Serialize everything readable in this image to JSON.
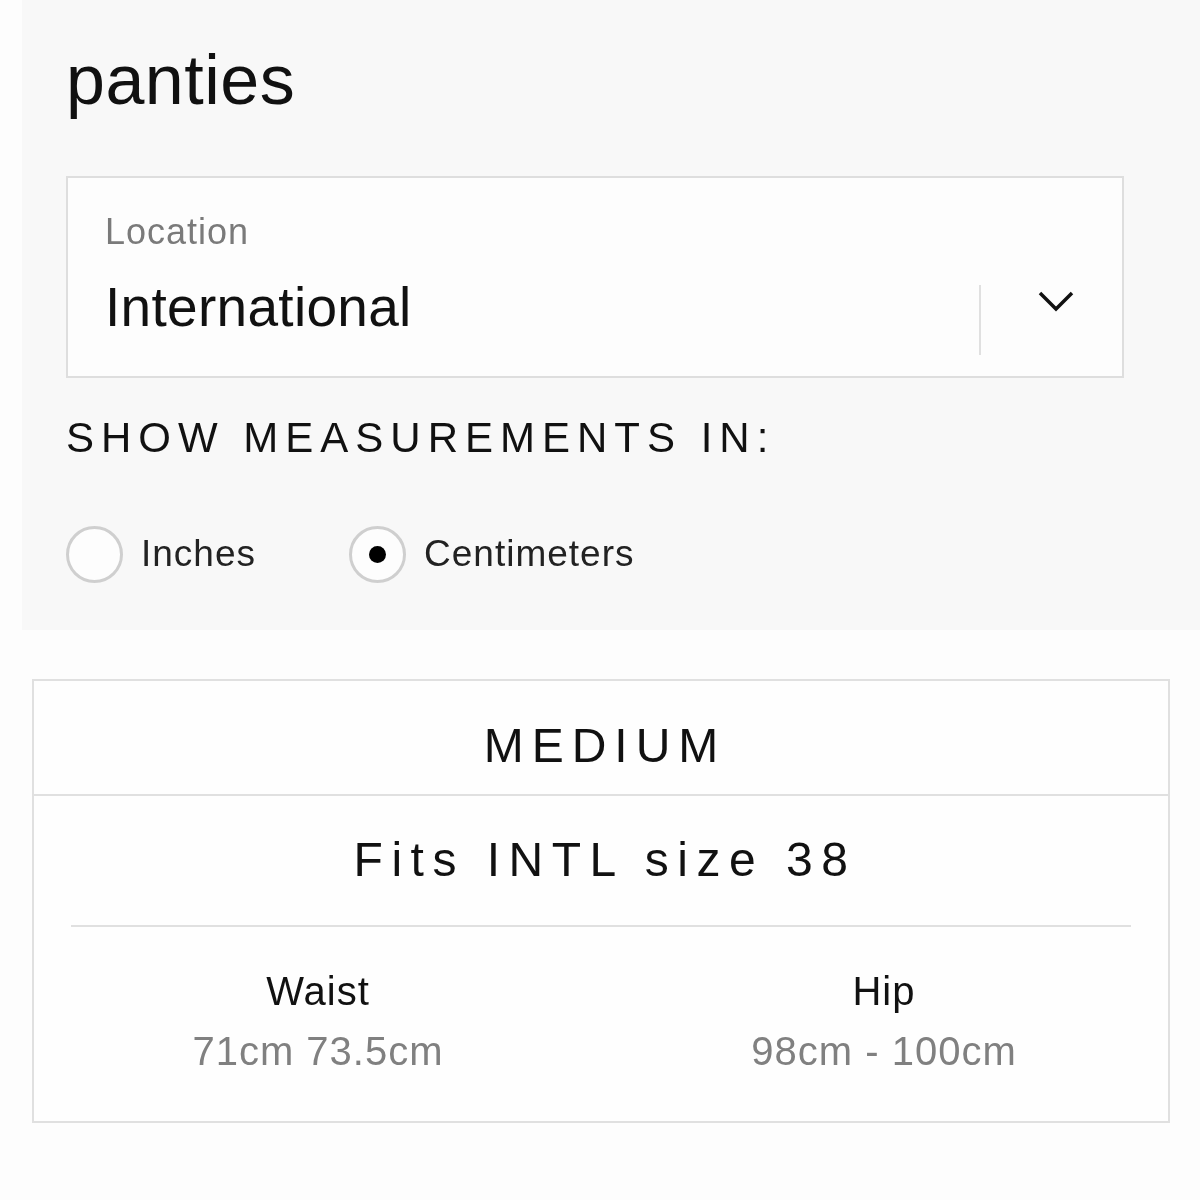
{
  "page_title": "panties",
  "location_select": {
    "label": "Location",
    "value": "International"
  },
  "measurement_units": {
    "heading": "SHOW MEASUREMENTS IN:",
    "options": [
      {
        "label": "Inches",
        "selected": false
      },
      {
        "label": "Centimeters",
        "selected": true
      }
    ]
  },
  "size_card": {
    "size": "MEDIUM",
    "fits": "Fits INTL size 38",
    "measurements": [
      {
        "name": "Waist",
        "value": "71cm 73.5cm"
      },
      {
        "name": "Hip",
        "value": "98cm - 100cm"
      }
    ]
  }
}
